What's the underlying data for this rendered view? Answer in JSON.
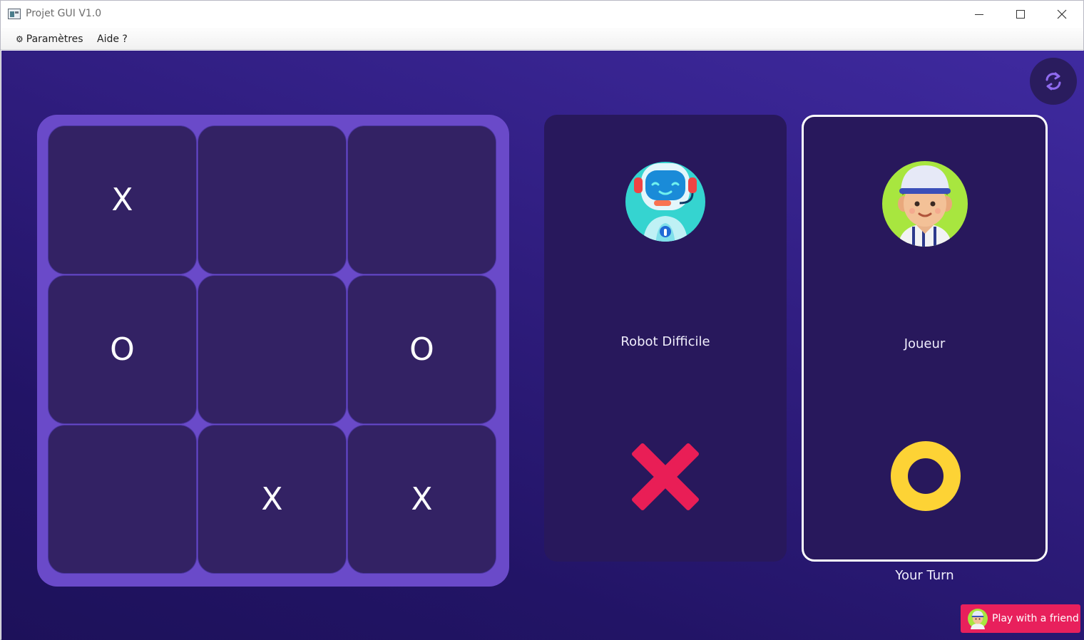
{
  "window": {
    "title": "Projet GUI V1.0"
  },
  "menu": {
    "settings_icon": "⚙",
    "settings_label": "Paramètres",
    "help_label": "Aide ?"
  },
  "board": {
    "cells": [
      "X",
      "",
      "",
      "O",
      "",
      "O",
      "",
      "X",
      "X"
    ]
  },
  "players": {
    "robot": {
      "name": "Robot Difficile",
      "avatar_icon": "robot-avatar-icon",
      "symbol": "X",
      "symbol_color": "#e91e56"
    },
    "player": {
      "name": "Joueur",
      "avatar_icon": "player-avatar-icon",
      "symbol": "O",
      "symbol_color": "#fdd335",
      "active": true
    }
  },
  "status": {
    "turn_label": "Your Turn"
  },
  "actions": {
    "reset_icon": "refresh-icon",
    "play_friend_label": "Play with a friend"
  },
  "colors": {
    "background": "#2e1c7c",
    "board_frame": "#6a4ac9",
    "cell": "#332264",
    "card": "#28185c",
    "accent_pink": "#e8205c"
  }
}
